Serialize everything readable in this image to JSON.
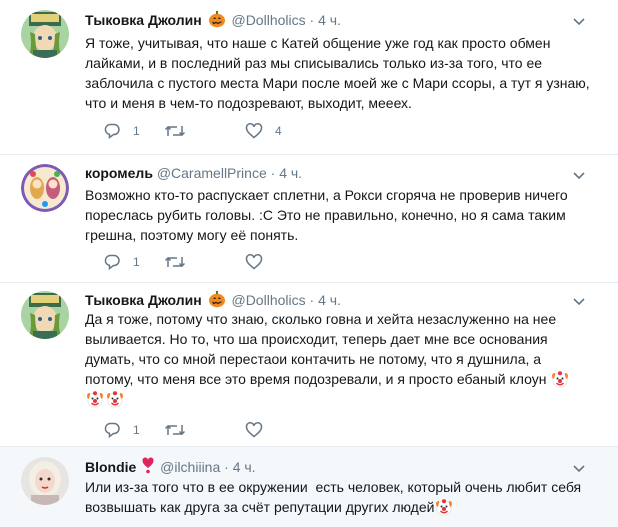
{
  "tweets": [
    {
      "name": "Тыковка Джолин",
      "handle": "@Dollholics",
      "dot": "·",
      "time": "4 ч.",
      "badge": "pumpkin-icon",
      "text": "Я тоже, учитывая, что наше с Катей общение уже год как просто обмен лайками, и в последний раз мы списывались только из-за того, что ее заблочила с пустого места Мари после моей же с Мари ссоры, а тут я узнаю, что и меня в чем-то подозревают, выходит, мееех.",
      "replies": "1",
      "retweets": "",
      "likes": "4"
    },
    {
      "name": "коромель",
      "handle": "@CaramellPrince",
      "dot": "·",
      "time": "4 ч.",
      "text": "Возможно кто-то распускает сплетни, а Рокси сгоряча не проверив ничего пореслась рубить головы. :С Это не правильно, конечно, но я сама таким грешна, поэтому могу её понять.",
      "replies": "1",
      "retweets": "",
      "likes": ""
    },
    {
      "name": "Тыковка Джолин",
      "handle": "@Dollholics",
      "dot": "·",
      "time": "4 ч.",
      "badge": "pumpkin-icon",
      "text": "Да я тоже, потому что знаю, сколько говна и хейта незаслуженно на нее выливается. Но то, что ша происходит, теперь дает мне все основания думать, что со мной перестаои контачить не потому, что я душнила, а потому, что меня все это время подозревали, и я просто ебаный клоун",
      "replies": "1",
      "retweets": "",
      "likes": ""
    },
    {
      "name": "Blondie",
      "handle": "@ilchiiina",
      "dot": "·",
      "time": "4 ч.",
      "badge": "heart-icon",
      "text": "Или из-за того что в ее окружении  есть человек, который очень любит себя возвышать как друга за счёт репутации других людей"
    }
  ],
  "icons": {
    "reply": "reply-icon",
    "retweet": "retweet-icon",
    "like": "like-icon",
    "menu": "chevron-down-icon",
    "clown": "clown-face-icon"
  },
  "colors": {
    "text": "#14171a",
    "secondary": "#657786",
    "divider": "#e6ecf0",
    "highlight_bg": "#f5f8fa"
  }
}
